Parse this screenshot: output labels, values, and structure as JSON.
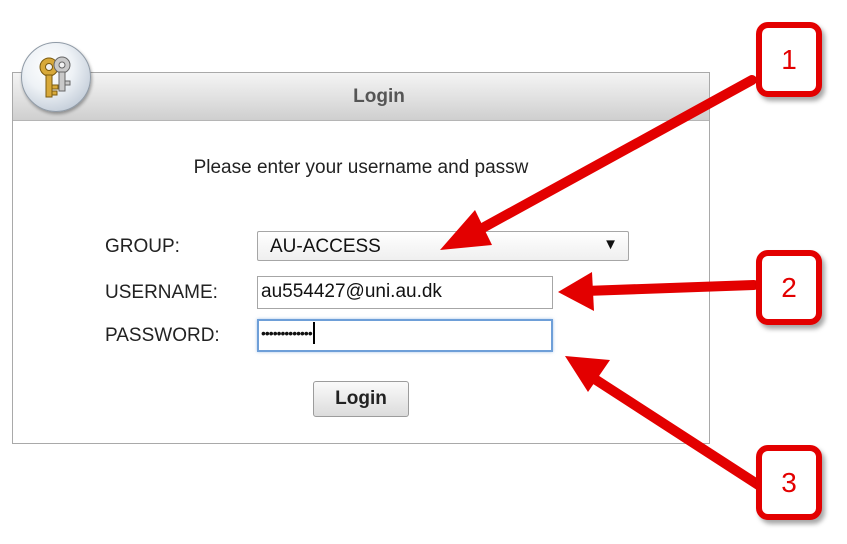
{
  "dialog": {
    "title": "Login",
    "instruction": "Please enter your username and passw"
  },
  "form": {
    "group_label": "GROUP:",
    "group_value": "AU-ACCESS",
    "username_label": "USERNAME:",
    "username_value": "au554427@uni.au.dk",
    "password_label": "PASSWORD:",
    "password_mask": "•••••••••••••",
    "login_button": "Login"
  },
  "callouts": [
    "1",
    "2",
    "3"
  ],
  "colors": {
    "annotation_red": "#e30000",
    "focus_border": "#6e9fd8"
  },
  "icons": {
    "logo": "keys-icon",
    "dropdown": "dropdown-arrow-icon"
  }
}
